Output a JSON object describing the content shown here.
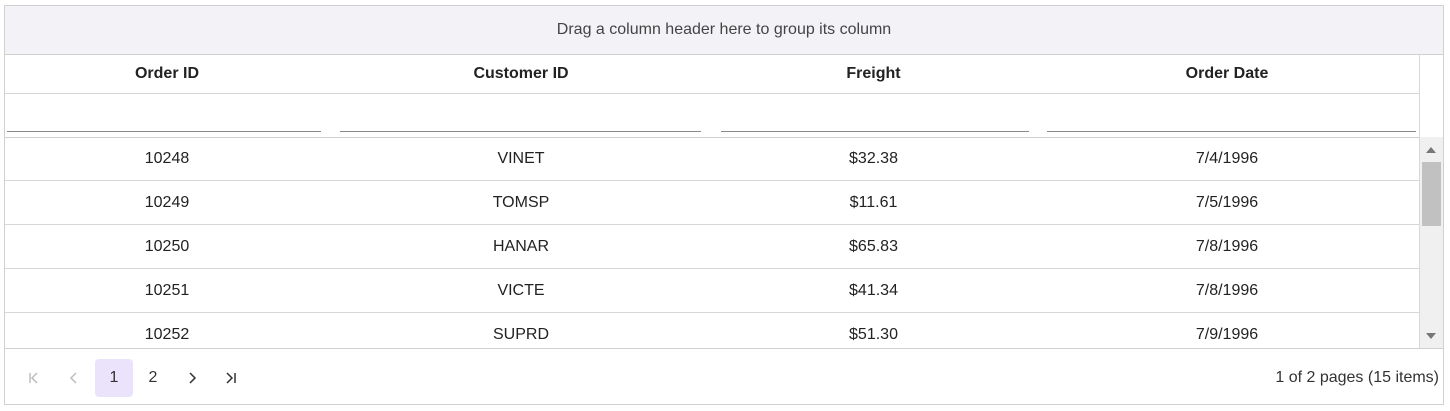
{
  "group_drop_text": "Drag a column header here to group its column",
  "columns": [
    {
      "label": "Order ID"
    },
    {
      "label": "Customer ID"
    },
    {
      "label": "Freight"
    },
    {
      "label": "Order Date"
    }
  ],
  "filters": [
    "",
    "",
    "",
    ""
  ],
  "rows": [
    [
      "10248",
      "VINET",
      "$32.38",
      "7/4/1996"
    ],
    [
      "10249",
      "TOMSP",
      "$11.61",
      "7/5/1996"
    ],
    [
      "10250",
      "HANAR",
      "$65.83",
      "7/8/1996"
    ],
    [
      "10251",
      "VICTE",
      "$41.34",
      "7/8/1996"
    ],
    [
      "10252",
      "SUPRD",
      "$51.30",
      "7/9/1996"
    ]
  ],
  "pager": {
    "pages": [
      "1",
      "2"
    ],
    "current_page": "1",
    "info": "1 of 2 pages (15 items)"
  },
  "icons": {
    "first": "first-page-icon",
    "prev": "previous-page-icon",
    "next": "next-page-icon",
    "last": "last-page-icon"
  },
  "colors": {
    "group_bg": "#f3f2f7",
    "active_page_bg": "#ebe3fc",
    "scroll_thumb": "#c1c1c1"
  }
}
